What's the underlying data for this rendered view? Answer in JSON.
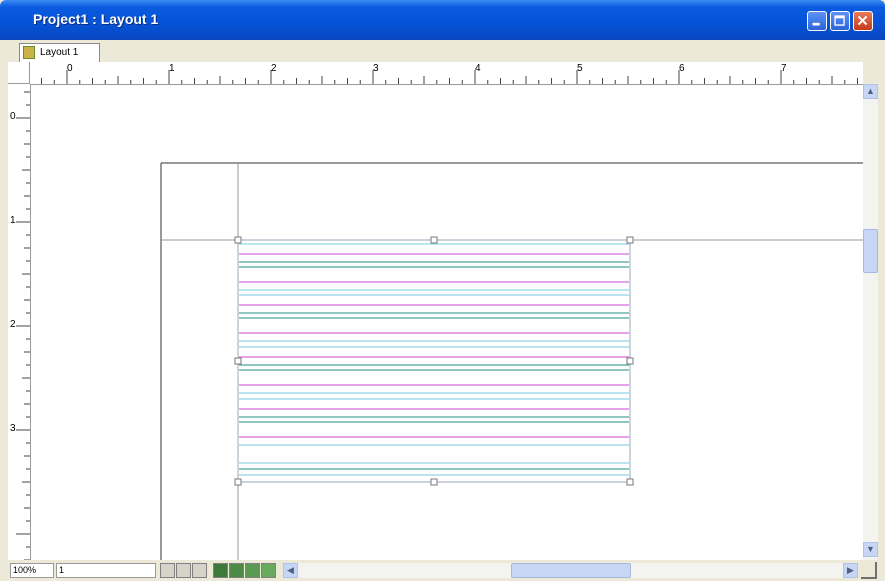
{
  "window": {
    "title": "Project1 : Layout 1"
  },
  "tab": {
    "label": "Layout 1"
  },
  "rulers": {
    "horizontal_labels": [
      "0",
      "1",
      "2",
      "3",
      "4",
      "5",
      "6",
      "7"
    ],
    "vertical_labels": [
      "0",
      "1",
      "2",
      "3"
    ]
  },
  "status": {
    "zoom": "100%",
    "page": "1"
  },
  "icons": {
    "tab_icon": "layout-icon",
    "minimize": "minimize-icon",
    "maximize": "maximize-icon",
    "close": "close-icon",
    "scroll_up": "chevron-up-icon",
    "scroll_down": "chevron-down-icon",
    "scroll_left": "chevron-left-icon",
    "scroll_right": "chevron-right-icon"
  },
  "colors": {
    "title_bar": "#0553d6",
    "label_line_magenta": "#d56ad8",
    "label_line_teal": "#4fa39a",
    "label_line_cyan": "#8fd3e8"
  }
}
